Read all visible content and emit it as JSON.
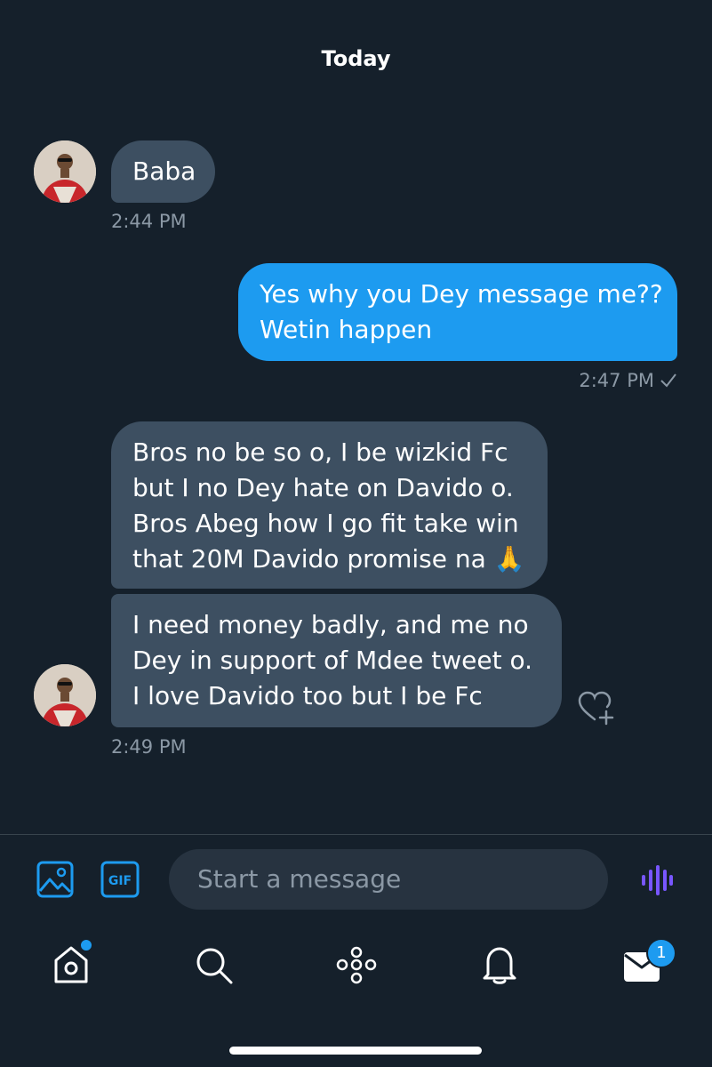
{
  "date_header": "Today",
  "messages": {
    "m1": {
      "sender": "other",
      "lines": [
        "Baba"
      ],
      "time": "2:44 PM"
    },
    "m2": {
      "sender": "me",
      "lines": [
        "Yes why you Dey message me??",
        "Wetin happen"
      ],
      "time": "2:47 PM",
      "status_icon": "checkmark-icon"
    },
    "m3": {
      "sender": "other",
      "lines": [
        "Bros no be so o, I be wizkid Fc",
        "but I no Dey hate on Davido o.",
        "Bros Abeg how I go fit take win",
        "that 20M Davido promise na 🙏"
      ]
    },
    "m4": {
      "sender": "other",
      "lines": [
        "I need money badly, and me no",
        "Dey in support of Mdee tweet o.",
        "I love Davido too but I be Fc"
      ],
      "time": "2:49 PM",
      "reaction_icon": "add-reaction-heart-icon"
    }
  },
  "composer": {
    "placeholder": "Start a message",
    "gif_label": "GIF",
    "icons": [
      "image-icon",
      "gif-icon",
      "voice-message-icon"
    ]
  },
  "tab_bar": {
    "items": [
      "home-icon",
      "search-icon",
      "spaces-icon",
      "notifications-icon",
      "messages-icon"
    ],
    "messages_badge": "1"
  },
  "colors": {
    "background": "#15202b",
    "incoming_bubble": "#3d4f61",
    "outgoing_bubble": "#1d9bf0",
    "timestamp": "#8b98a5",
    "accent": "#1d9bf0",
    "voice_icon": "#7856ff"
  }
}
